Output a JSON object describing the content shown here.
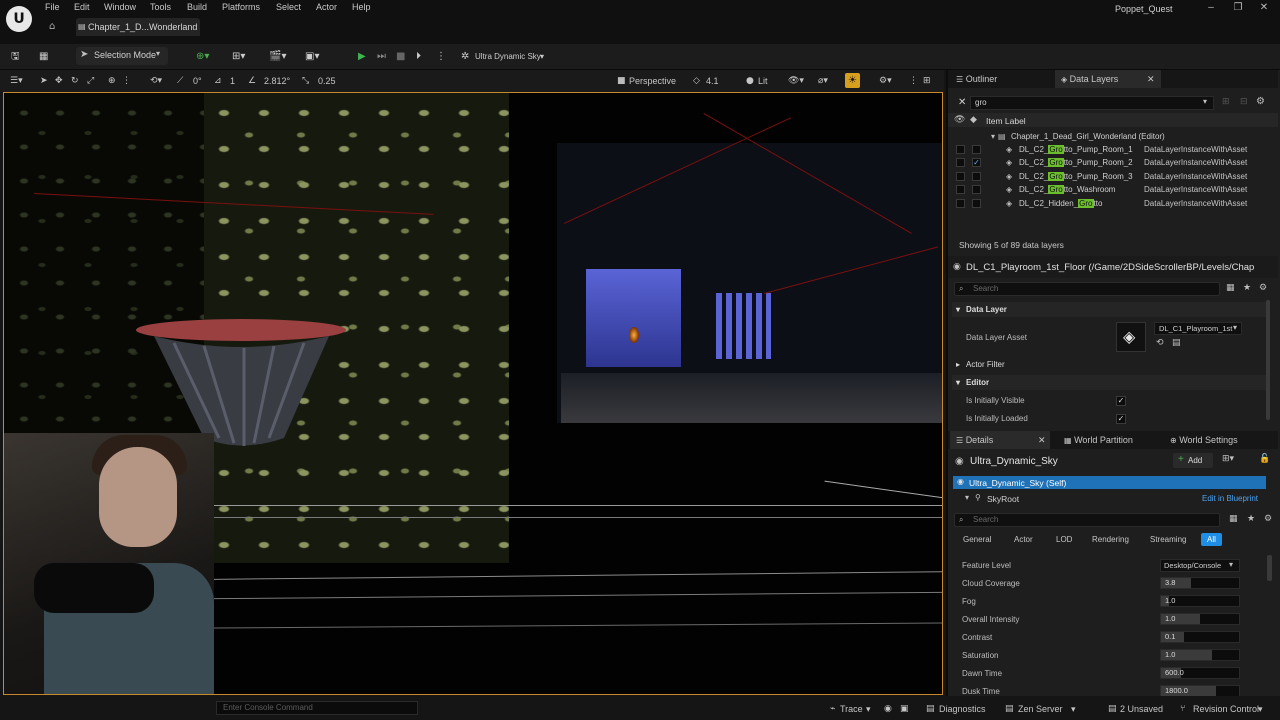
{
  "app": {
    "project_name": "Poppet_Quest",
    "level_tab": "Chapter_1_D...Wonderland",
    "menu": [
      "File",
      "Edit",
      "Window",
      "Tools",
      "Build",
      "Platforms",
      "Select",
      "Actor",
      "Help"
    ]
  },
  "toolbar": {
    "selection_mode": "Selection Mode",
    "sky_label": "Ultra Dynamic Sky"
  },
  "viewport_toolbar": {
    "rotation_snap": "0°",
    "grid_snap": "1",
    "scale": "2.812°",
    "camera_speed": "0.25",
    "view_mode_label": "Perspective",
    "fov": "4.1",
    "lit_label": "Lit"
  },
  "outliner": {
    "tab_outliner": "Outliner",
    "tab_data_layers": "Data Layers",
    "search_value": "gro",
    "column_header": "Item Label",
    "root_item": "Chapter_1_Dead_Girl_Wonderland (Editor)",
    "highlight": "Gro",
    "rows": [
      {
        "pre": "DL_C2_",
        "hl": "Gro",
        "post": "tto_Pump_Room_1",
        "type": "DataLayerInstanceWithAsset",
        "checked": false
      },
      {
        "pre": "DL_C2_",
        "hl": "Gro",
        "post": "tto_Pump_Room_2",
        "type": "DataLayerInstanceWithAsset",
        "checked": true
      },
      {
        "pre": "DL_C2_",
        "hl": "Gro",
        "post": "tto_Pump_Room_3",
        "type": "DataLayerInstanceWithAsset",
        "checked": false
      },
      {
        "pre": "DL_C2_",
        "hl": "Gro",
        "post": "tto_Washroom",
        "type": "DataLayerInstanceWithAsset",
        "checked": false
      },
      {
        "pre": "DL_C2_Hidden_",
        "hl": "Gro",
        "post": "tto",
        "type": "DataLayerInstanceWithAsset",
        "checked": false
      }
    ],
    "footer": "Showing 5 of 89 data layers"
  },
  "data_layer_details": {
    "title": "DL_C1_Playroom_1st_Floor (/Game/2DSideScrollerBP/Levels/Chap",
    "search_placeholder": "Search",
    "section_data_layer": "Data Layer",
    "asset_label": "Data Layer Asset",
    "asset_value": "DL_C1_Playroom_1st",
    "section_actor_filter": "Actor Filter",
    "section_editor": "Editor",
    "initially_visible_label": "Is Initially Visible",
    "initially_loaded_label": "Is Initially Loaded"
  },
  "details": {
    "tab_details": "Details",
    "tab_world_partition": "World Partition",
    "tab_world_settings": "World Settings",
    "actor_name": "Ultra_Dynamic_Sky",
    "add_label": "Add",
    "component_self": "Ultra_Dynamic_Sky (Self)",
    "component_root": "SkyRoot",
    "edit_in_blueprint": "Edit in Blueprint",
    "search_placeholder": "Search",
    "categories": [
      "General",
      "Actor",
      "LOD",
      "Rendering",
      "Streaming",
      "All"
    ],
    "active_category": "All",
    "feature_level_label": "Feature Level",
    "feature_level_value": "Desktop/Console",
    "properties": [
      {
        "label": "Cloud Coverage",
        "value": "3.8",
        "fill": 0.38
      },
      {
        "label": "Fog",
        "value": "1.0",
        "fill": 0.1
      },
      {
        "label": "Overall Intensity",
        "value": "1.0",
        "fill": 0.5
      },
      {
        "label": "Contrast",
        "value": "0.1",
        "fill": 0.3
      },
      {
        "label": "Saturation",
        "value": "1.0",
        "fill": 0.65
      },
      {
        "label": "Dawn Time",
        "value": "600.0",
        "fill": 0.25
      },
      {
        "label": "Dusk Time",
        "value": "1800.0",
        "fill": 0.7
      }
    ]
  },
  "statusbar": {
    "console_placeholder": "Enter Console Command",
    "trace": "Trace",
    "diagnostics": "Diagnostics",
    "zen_server": "Zen Server",
    "unsaved": "2 Unsaved",
    "revision_control": "Revision Control"
  },
  "colors": {
    "accent_blue": "#1f8fe6",
    "highlight_green": "#6bbf2c",
    "play_green": "#3fb34f",
    "viewport_border": "#c9892a"
  }
}
